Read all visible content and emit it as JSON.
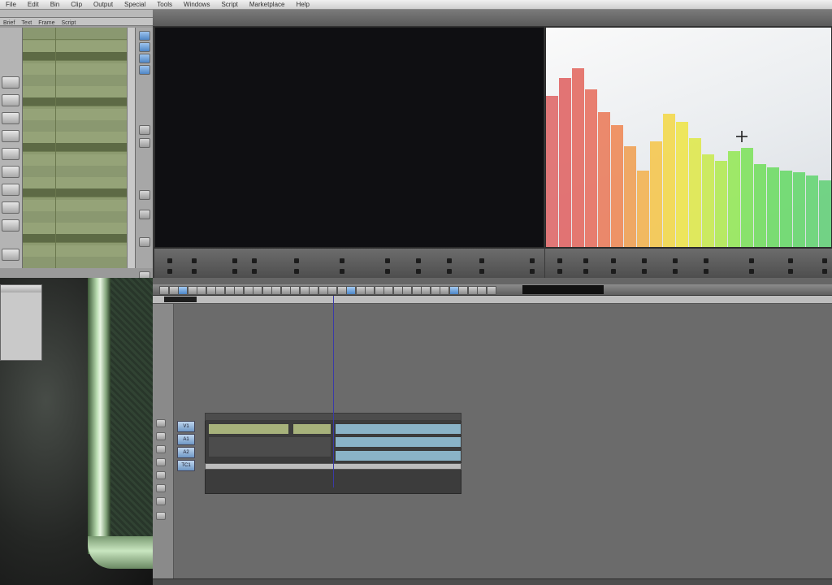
{
  "menu": {
    "items": [
      "File",
      "Edit",
      "Bin",
      "Clip",
      "Output",
      "Special",
      "Tools",
      "Windows",
      "Script",
      "Marketplace",
      "Help"
    ]
  },
  "bin": {
    "tabs": [
      "Brief",
      "Text",
      "Frame",
      "Script"
    ]
  },
  "timeline": {
    "tracks": [
      "V1",
      "A1",
      "A2",
      "TC1"
    ]
  },
  "colors": {
    "accent": "#5a8ed0",
    "bin_green": "#8c9a6f",
    "timeline_gray": "#6b6b6b"
  },
  "icons": [
    "crosshair-icon",
    "play-icon",
    "stop-icon",
    "mark-in-icon",
    "mark-out-icon"
  ]
}
